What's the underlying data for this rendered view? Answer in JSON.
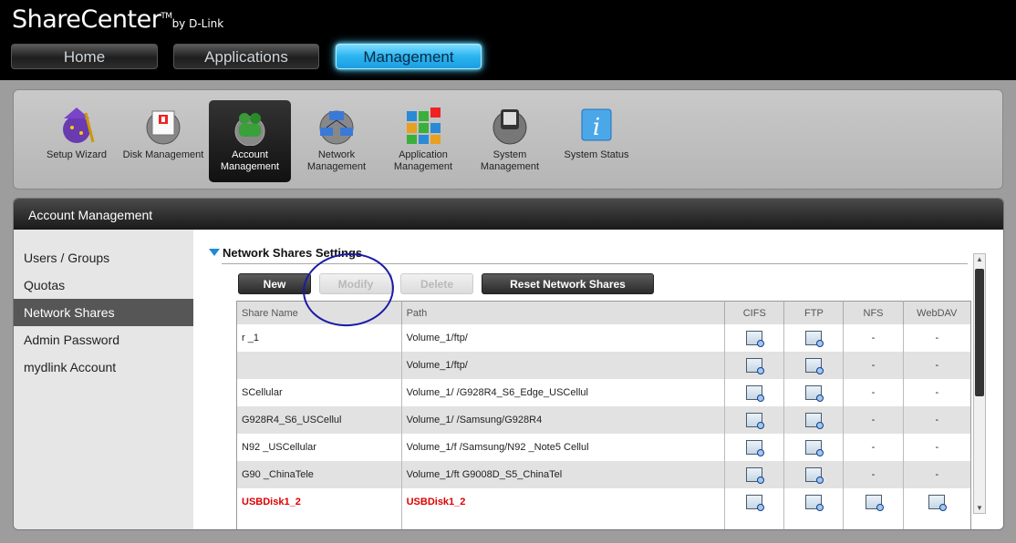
{
  "brand": {
    "name": "ShareCenter",
    "tm": "TM",
    "by": "by D-Link"
  },
  "topnav": [
    {
      "label": "Home"
    },
    {
      "label": "Applications"
    },
    {
      "label": "Management"
    }
  ],
  "iconbar": [
    {
      "label": "Setup Wizard",
      "icon": "wizard-icon"
    },
    {
      "label": "Disk Management",
      "icon": "disk-icon"
    },
    {
      "label": "Account Management",
      "icon": "account-icon"
    },
    {
      "label": "Network Management",
      "icon": "network-icon"
    },
    {
      "label": "Application Management",
      "icon": "application-icon"
    },
    {
      "label": "System Management",
      "icon": "system-icon"
    },
    {
      "label": "System Status",
      "icon": "info-icon"
    }
  ],
  "panel": {
    "title": "Account Management"
  },
  "sidebar": [
    {
      "label": "Users / Groups"
    },
    {
      "label": "Quotas"
    },
    {
      "label": "Network Shares"
    },
    {
      "label": "Admin Password"
    },
    {
      "label": "mydlink Account"
    }
  ],
  "section": {
    "title": "Network Shares Settings"
  },
  "buttons": {
    "new": "New",
    "modify": "Modify",
    "delete": "Delete",
    "reset": "Reset Network Shares"
  },
  "table": {
    "headers": [
      "Share Name",
      "Path",
      "CIFS",
      "FTP",
      "NFS",
      "WebDAV"
    ],
    "rows": [
      {
        "name": "r _1",
        "path": "Volume_1/ftp/",
        "cifs": "icon",
        "ftp": "icon",
        "nfs": "-",
        "webdav": "-"
      },
      {
        "name": "",
        "path": "Volume_1/ftp/",
        "cifs": "icon",
        "ftp": "icon",
        "nfs": "-",
        "webdav": "-"
      },
      {
        "name": "SCellular",
        "path": "Volume_1/ /G928R4_S6_Edge_USCellul",
        "cifs": "icon",
        "ftp": "icon",
        "nfs": "-",
        "webdav": "-"
      },
      {
        "name": "G928R4_S6_USCellul",
        "path": "Volume_1/ /Samsung/G928R4",
        "cifs": "icon",
        "ftp": "icon",
        "nfs": "-",
        "webdav": "-"
      },
      {
        "name": "N92 _USCellular",
        "path": "Volume_1/f /Samsung/N92 _Note5 Cellul",
        "cifs": "icon",
        "ftp": "icon",
        "nfs": "-",
        "webdav": "-"
      },
      {
        "name": "G90 _ChinaTele",
        "path": "Volume_1/ft G9008D_S5_ChinaTel",
        "cifs": "icon",
        "ftp": "icon",
        "nfs": "-",
        "webdav": "-"
      },
      {
        "name": "USBDisk1_2",
        "path": "USBDisk1_2",
        "cifs": "icon",
        "ftp": "icon",
        "nfs": "icon",
        "webdav": "icon",
        "usb": true
      }
    ]
  }
}
